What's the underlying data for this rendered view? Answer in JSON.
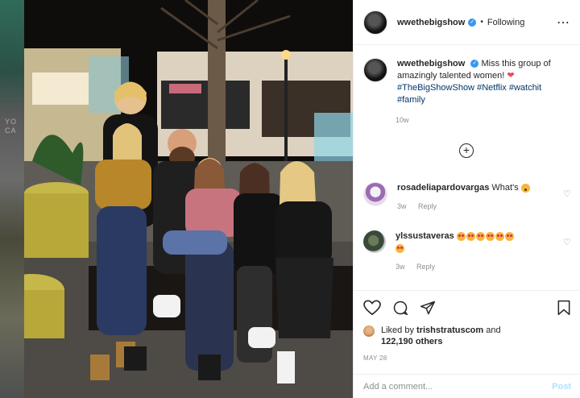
{
  "background": {
    "side_text": "YO\nCA"
  },
  "post": {
    "author": "wwethebigshow",
    "follow_status": "Following",
    "more_icon": "more-horizontal-icon",
    "caption_text": "Miss this group of amazingly talented women!",
    "hashtags": [
      "#TheBigShowShow",
      "#Netflix",
      "#watchit",
      "#family"
    ],
    "caption_age": "10w",
    "likes_by_user": "trishstratuscom",
    "likes_others": "122,190 others",
    "date": "MAY 28",
    "add_comment_placeholder": "Add a comment...",
    "post_label": "Post"
  },
  "comments": [
    {
      "user": "rosadeliapardovargas",
      "text": "What's",
      "age": "3w",
      "reply": "Reply"
    },
    {
      "user": "ylssustaveras",
      "text": "",
      "emoji_count": 7,
      "age": "3w",
      "reply": "Reply"
    }
  ],
  "labels": {
    "liked_by": "Liked by",
    "and": "and"
  },
  "colors": {
    "accent": "#3897f0",
    "link": "#00376b",
    "heart": "#ed4956"
  }
}
